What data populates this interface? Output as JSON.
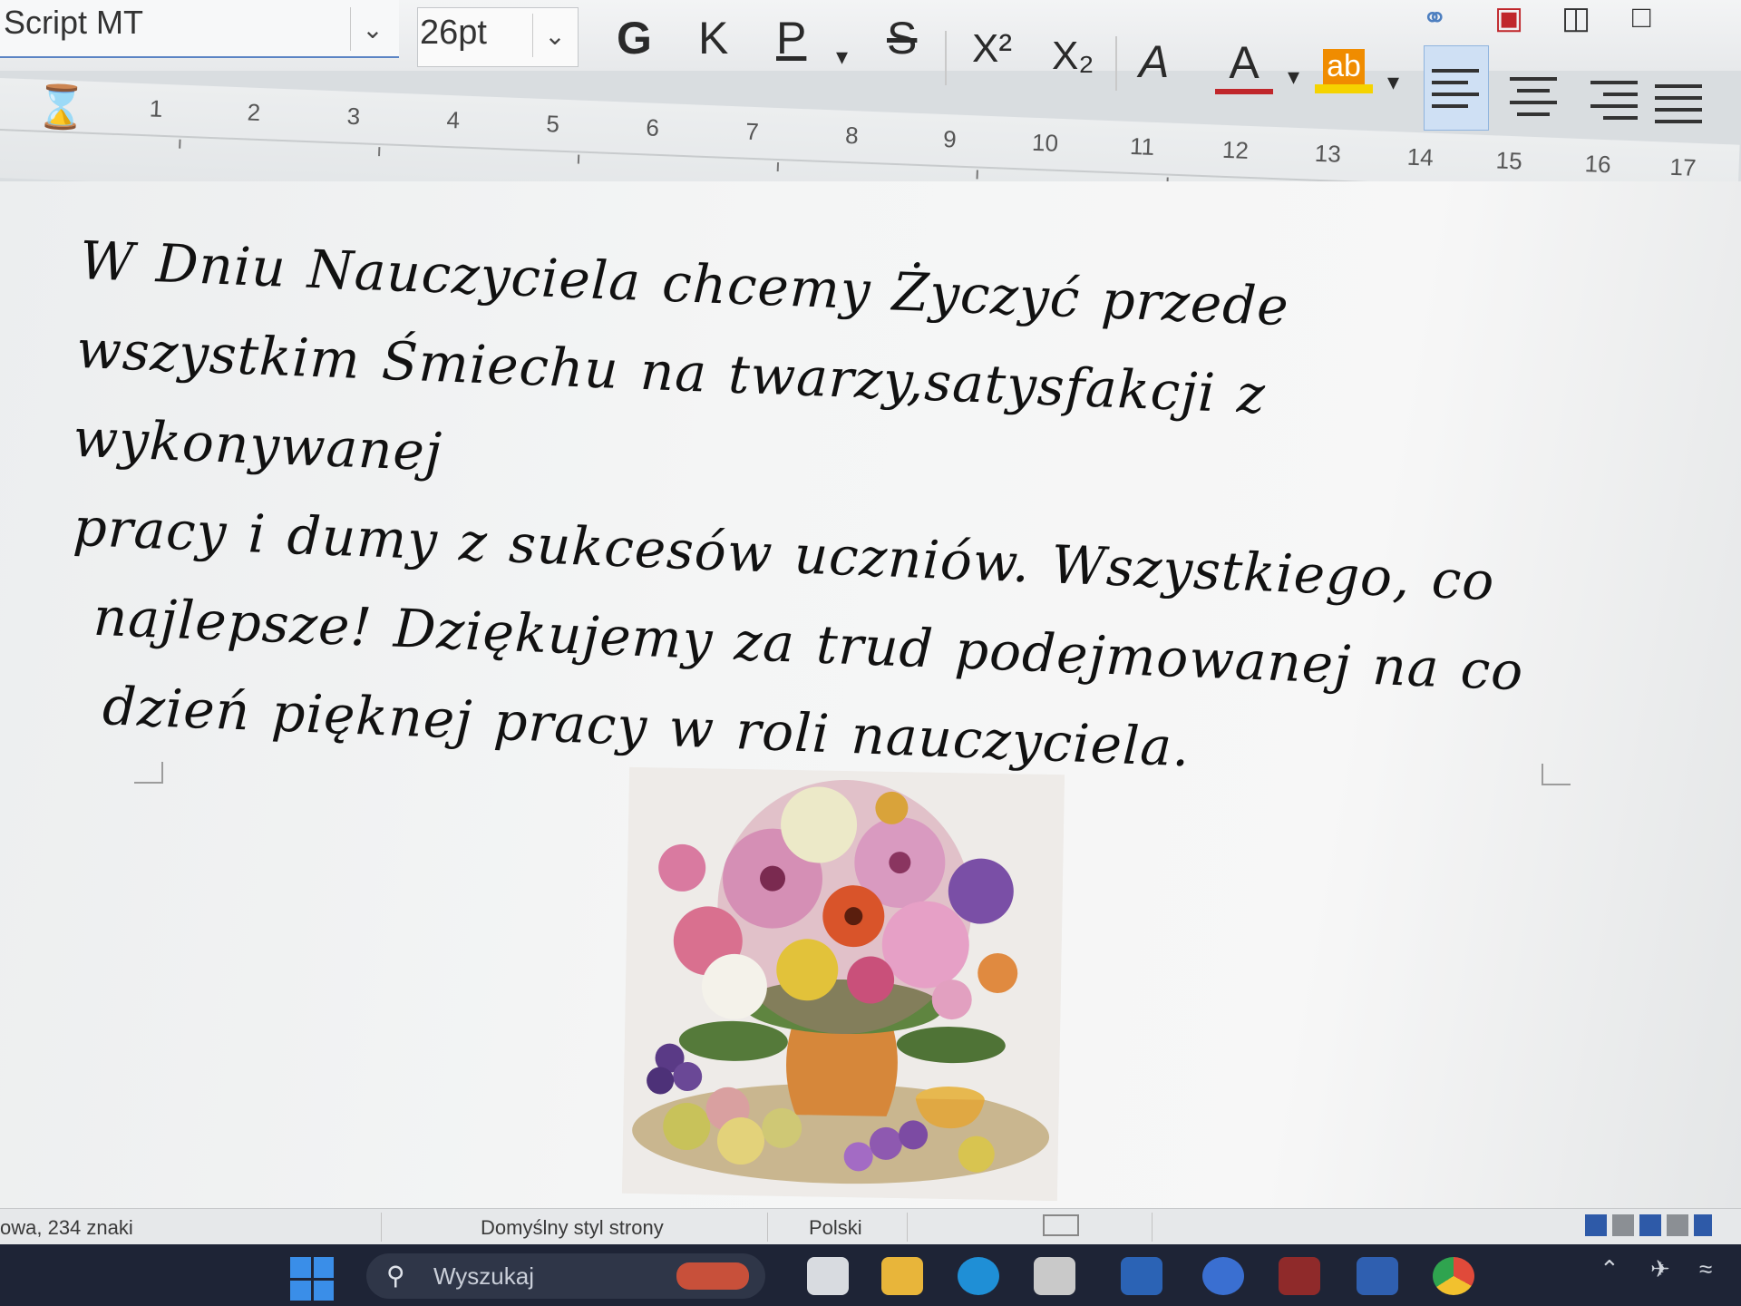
{
  "toolbar": {
    "font_name": "Script MT",
    "font_size": "26pt",
    "bold_label": "G",
    "italic_label": "K",
    "underline_label": "P",
    "strike_label": "S",
    "superscript_label": "X²",
    "subscript_label": "X₂",
    "highlight_label": "ab",
    "font_color_label": "A",
    "accent_color": "#5b84c4",
    "font_color": "#c0262b",
    "highlight_color": "#f5d300"
  },
  "ruler": {
    "ticks": [
      "1",
      "2",
      "3",
      "4",
      "5",
      "6",
      "7",
      "8",
      "9",
      "10",
      "11",
      "12",
      "13",
      "14",
      "15",
      "16",
      "17"
    ]
  },
  "document": {
    "paragraph": "W Dniu Nauczyciela chcemy Życzyć przede wszystkim Śmiechu na twarzy,satysfakcji z wykonywanej pracy i dumy z sukcesów uczniów. Wszystkiego, co najlepsze! Dziękujemy za trud podejmowanej na co dzień pięknej pracy w roli nauczyciela.",
    "lines": [
      "W Dniu Nauczyciela chcemy Życzyć przede",
      "wszystkim Śmiechu na twarzy,satysfakcji z wykonywanej",
      "pracy i dumy z sukcesów uczniów. Wszystkiego, co",
      "najlepsze! Dziękujemy za trud podejmowanej na co",
      "dzień pięknej pracy w roli nauczyciela."
    ]
  },
  "statusbar": {
    "word_count": "owa, 234 znaki",
    "page_style": "Domyślny styl strony",
    "language": "Polski"
  },
  "taskbar": {
    "search_placeholder": "Wyszukaj"
  }
}
